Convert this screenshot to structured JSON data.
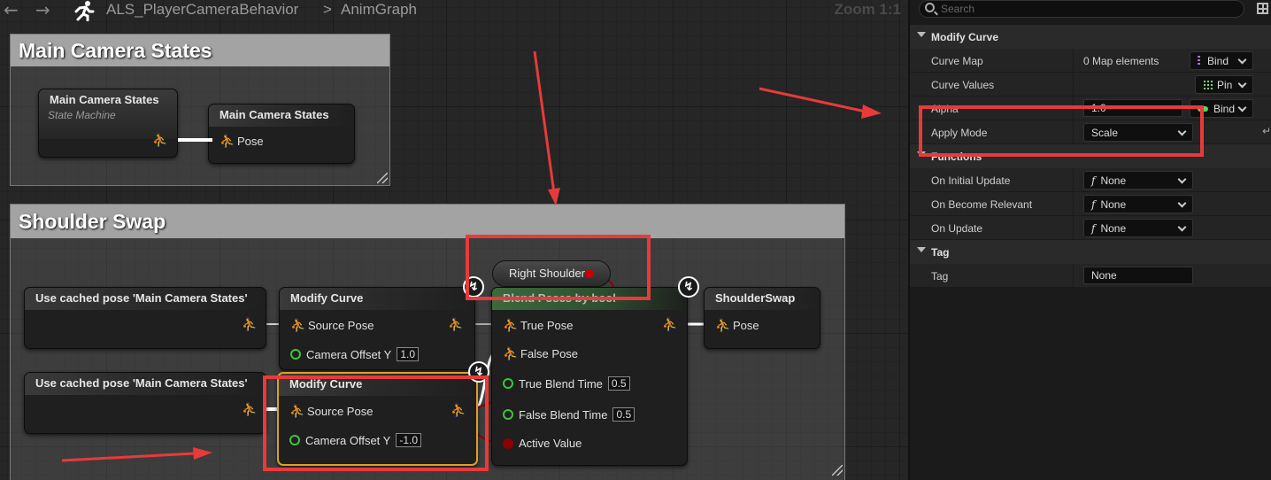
{
  "toolbar": {
    "breadcrumb_asset": "ALS_PlayerCameraBehavior",
    "breadcrumb_separator": ">",
    "breadcrumb_graph": "AnimGraph",
    "zoom": "Zoom 1:1"
  },
  "graph": {
    "comment_main": "Main Camera States",
    "comment_shoulder": "Shoulder Swap",
    "state_machine_node": {
      "title": "Main Camera States",
      "subtitle": "State Machine"
    },
    "state_result_node": {
      "title": "Main Camera States",
      "pin_pose": "Pose"
    },
    "cached_pose_1": {
      "title": "Use cached pose 'Main Camera States'"
    },
    "cached_pose_2": {
      "title": "Use cached pose 'Main Camera States'"
    },
    "modify_curve_1": {
      "title": "Modify Curve",
      "pin_source": "Source Pose",
      "pin_offset": "Camera Offset Y",
      "offset_value": "1.0"
    },
    "modify_curve_2": {
      "title": "Modify Curve",
      "pin_source": "Source Pose",
      "pin_offset": "Camera Offset Y",
      "offset_value": "-1.0"
    },
    "right_shoulder_var": "Right Shoulder",
    "blend_node": {
      "title": "Blend Poses by bool",
      "pin_true": "True Pose",
      "pin_false": "False Pose",
      "pin_true_time": "True Blend Time",
      "true_time_value": "0.5",
      "pin_false_time": "False Blend Time",
      "false_time_value": "0.5",
      "pin_active": "Active Value"
    },
    "shoulder_swap_node": {
      "title": "ShoulderSwap",
      "pin_pose": "Pose"
    }
  },
  "details": {
    "search_placeholder": "Search",
    "section_modify_curve": "Modify Curve",
    "curve_map": {
      "label": "Curve Map",
      "value": "0 Map elements",
      "bind": "Bind"
    },
    "curve_values": {
      "label": "Curve Values",
      "pin": "Pin"
    },
    "alpha": {
      "label": "Alpha",
      "value": "1.0",
      "bind": "Bind"
    },
    "apply_mode": {
      "label": "Apply Mode",
      "value": "Scale"
    },
    "section_functions": "Functions",
    "on_initial_update": {
      "label": "On Initial Update",
      "value": "None"
    },
    "on_become_relevant": {
      "label": "On Become Relevant",
      "value": "None"
    },
    "on_update": {
      "label": "On Update",
      "value": "None"
    },
    "section_tag": "Tag",
    "tag": {
      "label": "Tag",
      "value": "None"
    }
  },
  "colors": {
    "highlight_red": "#e83a3a",
    "float_pin_green": "#3fc43f",
    "bool_pin_red": "#8b0000",
    "selected_node_orange": "#e0a020"
  },
  "icons": {
    "pose": "person-pose-icon",
    "exec": "lightning-bolt-icon",
    "function": "function-f-icon"
  }
}
